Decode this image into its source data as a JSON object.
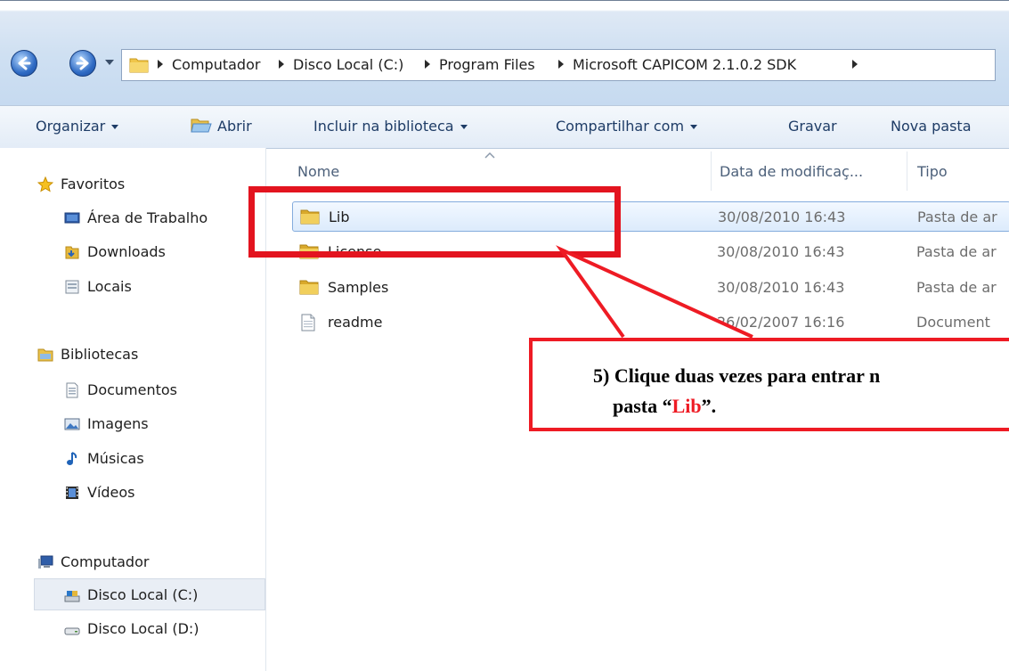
{
  "address": {
    "crumbs": [
      "Computador",
      "Disco Local (C:)",
      "Program Files",
      "Microsoft CAPICOM 2.1.0.2 SDK"
    ]
  },
  "toolbar": {
    "organize": "Organizar",
    "open": "Abrir",
    "include": "Incluir na biblioteca",
    "share": "Compartilhar com",
    "burn": "Gravar",
    "new_folder": "Nova pasta"
  },
  "sidebar": {
    "favorites": "Favoritos",
    "favorites_items": [
      "Área de Trabalho",
      "Downloads",
      "Locais"
    ],
    "libraries": "Bibliotecas",
    "libraries_items": [
      "Documentos",
      "Imagens",
      "Músicas",
      "Vídeos"
    ],
    "computer": "Computador",
    "computer_items": [
      "Disco Local (C:)",
      "Disco Local (D:)"
    ]
  },
  "columns": {
    "name": "Nome",
    "date": "Data de modificaç...",
    "type": "Tipo"
  },
  "files": [
    {
      "name": "Lib",
      "date": "30/08/2010 16:43",
      "type": "Pasta de ar"
    },
    {
      "name": "License",
      "date": "30/08/2010 16:43",
      "type": "Pasta de ar"
    },
    {
      "name": "Samples",
      "date": "30/08/2010 16:43",
      "type": "Pasta de ar"
    },
    {
      "name": "readme",
      "date": "26/02/2007 16:16",
      "type": "Document"
    }
  ],
  "callout": {
    "line1": "5)  Clique duas vezes para entrar n",
    "line2_prefix": "pasta “",
    "line2_highlight": "Lib",
    "line2_suffix": "”."
  },
  "colors": {
    "annotation_red": "#ee1b24",
    "selection_blue": "#dcebfc"
  },
  "icons": {
    "back": "back-arrow-icon",
    "forward": "forward-arrow-icon",
    "folder": "folder-icon",
    "document": "document-icon",
    "star": "star-icon",
    "desktop": "desktop-icon",
    "drive": "drive-icon"
  }
}
